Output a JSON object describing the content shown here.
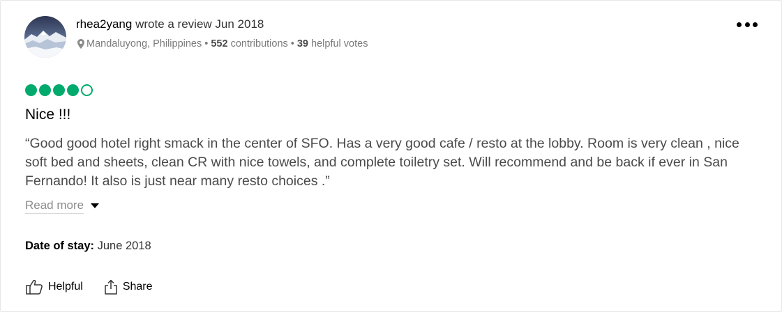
{
  "review": {
    "author": "rhea2yang",
    "action_text": "wrote a review Jun 2018",
    "location": "Mandaluyong, Philippines",
    "contributions_count": "552",
    "contributions_label": "contributions",
    "helpful_count": "39",
    "helpful_label": "helpful votes",
    "rating": {
      "value": 4,
      "max": 5,
      "color": "#00aa6c"
    },
    "title": "Nice !!!",
    "text": "“Good good hotel right smack in the center of SFO. Has a very good cafe / resto at the lobby. Room is very clean , nice soft bed and sheets, clean CR with nice towels, and complete toiletry set. Will recommend and be back if ever in San Fernando! It also is just near many resto choices .”",
    "read_more_label": "Read more",
    "date_of_stay_label": "Date of stay:",
    "date_of_stay_value": "June 2018"
  },
  "actions": {
    "helpful_label": "Helpful",
    "share_label": "Share"
  },
  "icons": {
    "location": "map-pin-icon",
    "more": "more-options-icon",
    "helpful": "thumbs-up-icon",
    "share": "share-icon"
  }
}
